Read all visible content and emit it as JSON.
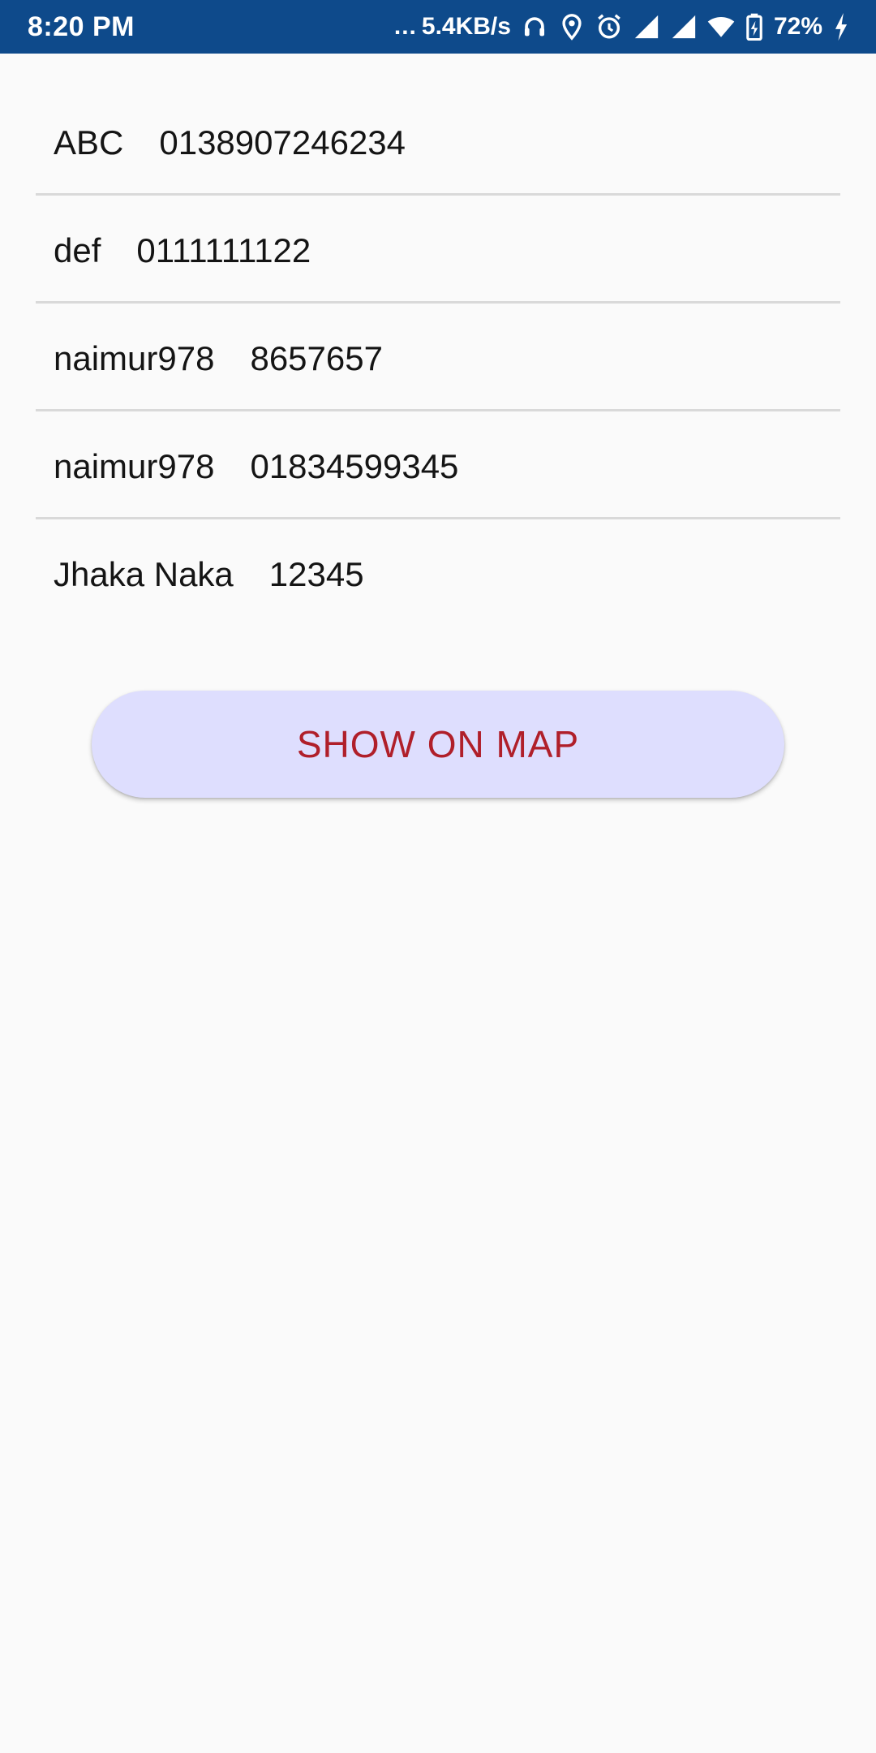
{
  "status_bar": {
    "time": "8:20 PM",
    "dots": "...",
    "network_speed": "5.4KB/s",
    "battery_percent": "72%",
    "icons": [
      "headphones-icon",
      "location-icon",
      "alarm-icon",
      "signal-icon",
      "signal-icon",
      "wifi-icon",
      "battery-icon",
      "charging-icon"
    ],
    "background_color": "#0e4a8b"
  },
  "contacts": [
    {
      "name": "ABC",
      "phone": "0138907246234"
    },
    {
      "name": "def",
      "phone": "0111111122"
    },
    {
      "name": "naimur978",
      "phone": "8657657"
    },
    {
      "name": "naimur978",
      "phone": "01834599345"
    },
    {
      "name": "Jhaka Naka",
      "phone": "12345"
    }
  ],
  "button": {
    "label": "SHOW ON MAP",
    "text_color": "#b01f2a",
    "background_color": "#dedefe"
  }
}
